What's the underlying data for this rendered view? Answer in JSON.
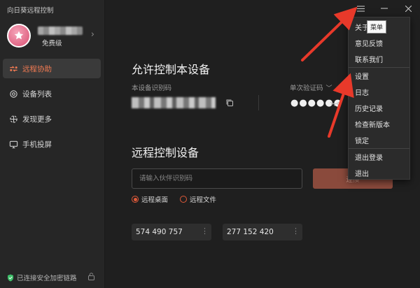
{
  "app": {
    "title": "向日葵远程控制"
  },
  "profile": {
    "level": "免费级"
  },
  "nav": [
    {
      "label": "远程协助",
      "icon": "remote-assist-icon",
      "active": true
    },
    {
      "label": "设备列表",
      "icon": "device-list-icon",
      "active": false
    },
    {
      "label": "发现更多",
      "icon": "discover-icon",
      "active": false
    },
    {
      "label": "手机投屏",
      "icon": "screen-cast-icon",
      "active": false
    }
  ],
  "footer": {
    "status": "已连接安全加密链路"
  },
  "allow": {
    "title": "允许控制本设备",
    "device_id_label": "本设备识别码",
    "otp_label": "单次验证码",
    "otp_value": "●●●●●●"
  },
  "remote": {
    "title": "远程控制设备",
    "input_placeholder": "请输入伙伴识别码",
    "connect_label": "连接",
    "modes": [
      {
        "label": "远程桌面",
        "checked": true
      },
      {
        "label": "远程文件",
        "checked": false
      }
    ],
    "recent": [
      "574 490 757",
      "277 152 420"
    ]
  },
  "menu": {
    "tooltip": "菜单",
    "items": [
      "关于",
      "意见反馈",
      "联系我们",
      "设置",
      "日志",
      "历史记录",
      "检查新版本",
      "锁定",
      "退出登录",
      "退出"
    ]
  },
  "colors": {
    "accent": "#f07a52",
    "arrow": "#e8392a",
    "connect_bg": "#8a4a3c"
  }
}
